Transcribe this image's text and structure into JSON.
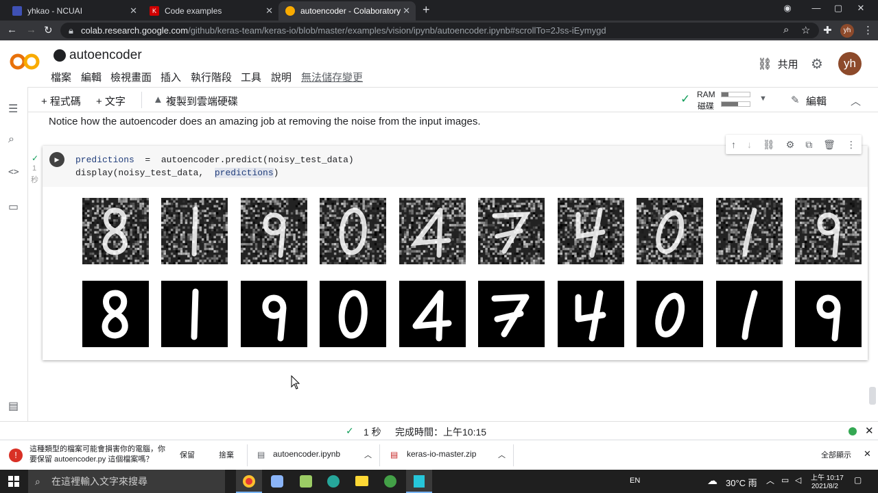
{
  "browser": {
    "tabs": [
      {
        "title": "yhkao - NCUAI",
        "icon": "doc-icon",
        "color": "#3f51b5"
      },
      {
        "title": "Code examples",
        "icon": "keras-icon",
        "color": "#d00000"
      },
      {
        "title": "autoencoder - Colaboratory",
        "icon": "colab-icon",
        "color": "#f9ab00"
      }
    ],
    "url_host": "colab.research.google.com",
    "url_path": "/github/keras-team/keras-io/blob/master/examples/vision/ipynb/autoencoder.ipynb#scrollTo=2Jss-iEymygd",
    "profile": "yh"
  },
  "header": {
    "title": "autoencoder",
    "menu": [
      "檔案",
      "編輯",
      "檢視畫面",
      "插入",
      "執行階段",
      "工具",
      "說明",
      "無法儲存變更"
    ],
    "share_label": "共用",
    "avatar": "yh"
  },
  "nbbar": {
    "add_code": "+ 程式碼",
    "add_text": "+ 文字",
    "copy_drive": "複製到雲端硬碟",
    "ram_label": "RAM",
    "disk_label": "磁碟",
    "edit_label": "編輯"
  },
  "text_cell": "Notice how the autoencoder does an amazing job at removing the noise from the input images.",
  "code_cell": {
    "exec_count": "1",
    "exec_unit": "秒",
    "line1_a": "predictions",
    "line1_b": "  =  autoencoder.predict(noisy_test_data)",
    "line2_a": "display(noisy_test_data,  ",
    "line2_b": "predictions",
    "line2_c": ")"
  },
  "digits": [
    "8",
    "1",
    "9",
    "0",
    "4",
    "7",
    "4",
    "0",
    "1",
    "9"
  ],
  "status": {
    "time": "1 秒",
    "done": "完成時間：上午10:15"
  },
  "downloads": {
    "warning": "這種類型的檔案可能會損害你的電腦，你要保留 autoencoder.py 這個檔案嗎？",
    "keep": "保留",
    "discard": "捨棄",
    "file1": "autoencoder.ipynb",
    "file2": "keras-io-master.zip",
    "show_all": "全部顯示"
  },
  "taskbar": {
    "search_placeholder": "在這裡輸入文字來搜尋",
    "lang": "EN",
    "weather": "30°C 雨",
    "time": "上午 10:17",
    "date": "2021/8/2"
  }
}
